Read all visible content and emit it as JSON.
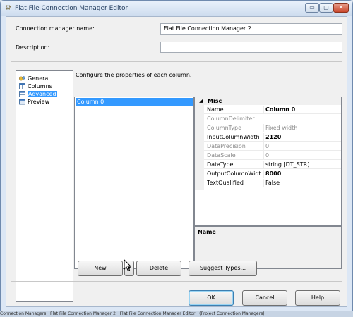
{
  "window": {
    "title": "Flat File Connection Manager Editor",
    "title_icon": "gear-icon",
    "controls": {
      "minimize": "▭",
      "maximize": "▢",
      "close": "✕"
    }
  },
  "fields": {
    "name_label": "Connection manager name:",
    "name_value": "Flat File Connection Manager 2",
    "description_label": "Description:",
    "description_value": ""
  },
  "nav": {
    "items": [
      {
        "label": "General",
        "icon": "general-page-icon",
        "selected": false
      },
      {
        "label": "Columns",
        "icon": "columns-page-icon",
        "selected": false
      },
      {
        "label": "Advanced",
        "icon": "advanced-page-icon",
        "selected": true
      },
      {
        "label": "Preview",
        "icon": "preview-page-icon",
        "selected": false
      }
    ]
  },
  "main": {
    "instruction": "Configure the properties of each column.",
    "columns": [
      "Column 0"
    ],
    "properties": {
      "category": "Misc",
      "rows": [
        {
          "name": "Name",
          "value": "Column 0",
          "enabled": true,
          "bold": true
        },
        {
          "name": "ColumnDelimiter",
          "value": "",
          "enabled": false,
          "bold": false
        },
        {
          "name": "ColumnType",
          "value": "Fixed width",
          "enabled": false,
          "bold": false
        },
        {
          "name": "InputColumnWidth",
          "value": "2120",
          "enabled": true,
          "bold": true
        },
        {
          "name": "DataPrecision",
          "value": "0",
          "enabled": false,
          "bold": false
        },
        {
          "name": "DataScale",
          "value": "0",
          "enabled": false,
          "bold": false
        },
        {
          "name": "DataType",
          "value": "string [DT_STR]",
          "enabled": true,
          "bold": false
        },
        {
          "name": "OutputColumnWidth",
          "value": "8000",
          "enabled": true,
          "bold": true
        },
        {
          "name": "TextQualified",
          "value": "False",
          "enabled": true,
          "bold": false
        }
      ],
      "description_title": "Name"
    },
    "buttons": {
      "new": "New",
      "new_dropdown": "▾",
      "delete": "Delete",
      "suggest": "Suggest Types..."
    }
  },
  "footer": {
    "ok": "OK",
    "cancel": "Cancel",
    "help": "Help"
  },
  "taskbar": {
    "text": "Connection Managers  ·  Flat File Connection Manager 2  ·  Flat File Connection Manager Editor  ·  (Project Connection Managers)"
  },
  "colors": {
    "selection": "#3399ff",
    "title_text": "#1e395b",
    "close_button": "#c9462c"
  }
}
